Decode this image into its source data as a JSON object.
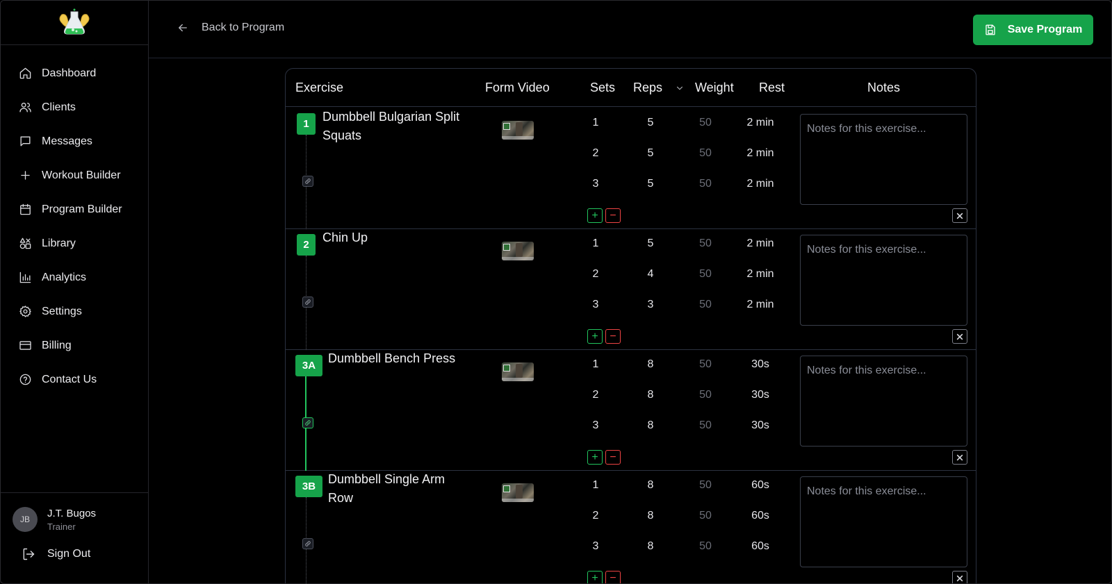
{
  "sidebar": {
    "items": [
      {
        "label": "Dashboard",
        "icon": "home-icon"
      },
      {
        "label": "Clients",
        "icon": "users-icon"
      },
      {
        "label": "Messages",
        "icon": "message-icon"
      },
      {
        "label": "Workout Builder",
        "icon": "plus-icon"
      },
      {
        "label": "Program Builder",
        "icon": "calendar-icon"
      },
      {
        "label": "Library",
        "icon": "shapes-icon"
      },
      {
        "label": "Analytics",
        "icon": "bar-chart-icon"
      },
      {
        "label": "Settings",
        "icon": "gear-icon"
      },
      {
        "label": "Billing",
        "icon": "credit-card-icon"
      },
      {
        "label": "Contact Us",
        "icon": "help-circle-icon"
      }
    ],
    "user": {
      "initials": "JB",
      "name": "J.T. Bugos",
      "role": "Trainer"
    },
    "sign_out": "Sign Out"
  },
  "header": {
    "back_label": "Back to Program",
    "save_label": "Save Program",
    "accent": "#16a34a"
  },
  "table": {
    "columns": {
      "exercise": "Exercise",
      "form_video": "Form Video",
      "sets": "Sets",
      "reps": "Reps",
      "weight": "Weight",
      "rest": "Rest",
      "notes": "Notes"
    },
    "rows": [
      {
        "badge": "1",
        "name": "Dumbbell Bulgarian Split Squats",
        "superset": false,
        "sets": [
          {
            "set": "1",
            "reps": "5",
            "weight": "50",
            "rest": "2 min"
          },
          {
            "set": "2",
            "reps": "5",
            "weight": "50",
            "rest": "2 min"
          },
          {
            "set": "3",
            "reps": "5",
            "weight": "50",
            "rest": "2 min"
          }
        ],
        "notes_placeholder": "Notes for this exercise..."
      },
      {
        "badge": "2",
        "name": "Chin Up",
        "superset": false,
        "sets": [
          {
            "set": "1",
            "reps": "5",
            "weight": "50",
            "rest": "2 min"
          },
          {
            "set": "2",
            "reps": "4",
            "weight": "50",
            "rest": "2 min"
          },
          {
            "set": "3",
            "reps": "3",
            "weight": "50",
            "rest": "2 min"
          }
        ],
        "notes_placeholder": "Notes for this exercise..."
      },
      {
        "badge": "3A",
        "name": "Dumbbell Bench Press",
        "superset": true,
        "sets": [
          {
            "set": "1",
            "reps": "8",
            "weight": "50",
            "rest": "30s"
          },
          {
            "set": "2",
            "reps": "8",
            "weight": "50",
            "rest": "30s"
          },
          {
            "set": "3",
            "reps": "8",
            "weight": "50",
            "rest": "30s"
          }
        ],
        "notes_placeholder": "Notes for this exercise..."
      },
      {
        "badge": "3B",
        "name": "Dumbbell Single Arm Row",
        "superset": false,
        "sets": [
          {
            "set": "1",
            "reps": "8",
            "weight": "50",
            "rest": "60s"
          },
          {
            "set": "2",
            "reps": "8",
            "weight": "50",
            "rest": "60s"
          },
          {
            "set": "3",
            "reps": "8",
            "weight": "50",
            "rest": "60s"
          }
        ],
        "notes_placeholder": "Notes for this exercise..."
      }
    ]
  }
}
